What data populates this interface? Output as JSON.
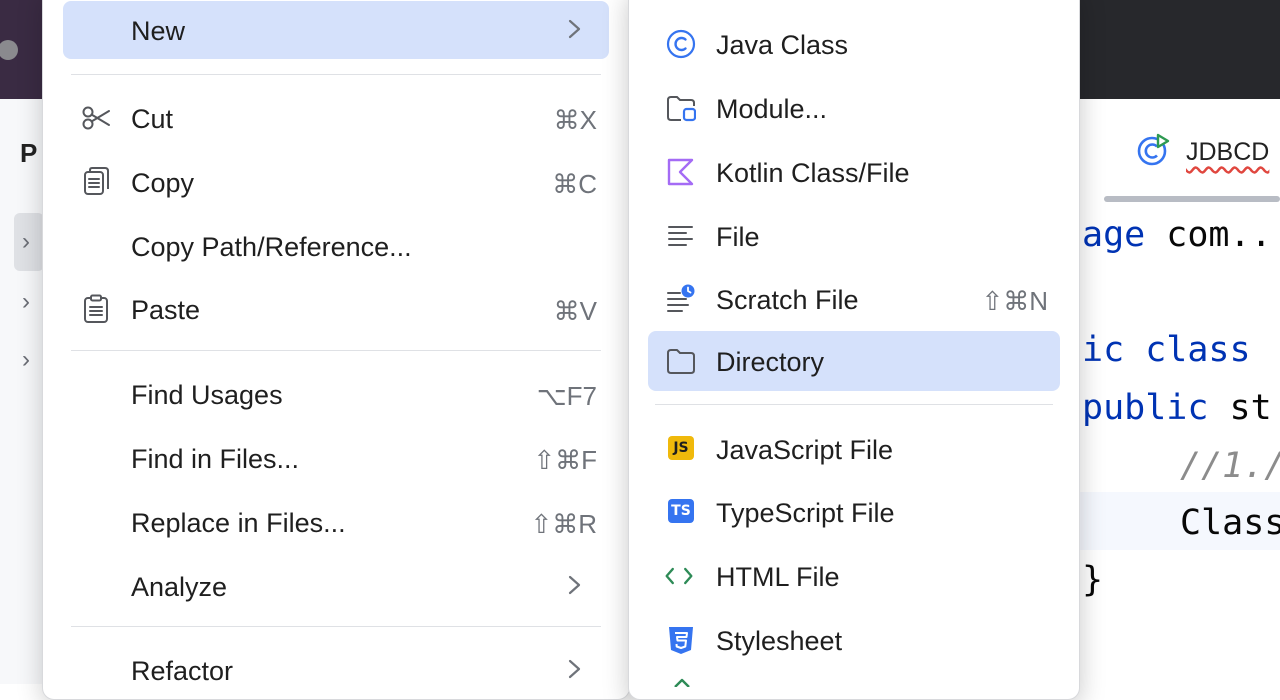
{
  "editor": {
    "project_label": "P",
    "tab_label": "JDBCD",
    "code_lines": [
      {
        "kw": "age",
        "pl": " com.."
      },
      {
        "kw": "ic class",
        "pl": ""
      },
      {
        "kw": "public",
        "pl": " st"
      },
      {
        "cm": "//1./"
      },
      {
        "pl": "Class"
      },
      {
        "pl": "}"
      }
    ]
  },
  "menu": {
    "items": [
      {
        "label": "New",
        "shortcut": "",
        "icon": "",
        "submenu": true,
        "selected": true
      },
      {
        "label": "Cut",
        "shortcut": "⌘X",
        "icon": "scissors-icon"
      },
      {
        "label": "Copy",
        "shortcut": "⌘C",
        "icon": "copy-icon"
      },
      {
        "label": "Copy Path/Reference...",
        "shortcut": "",
        "icon": ""
      },
      {
        "label": "Paste",
        "shortcut": "⌘V",
        "icon": "clipboard-icon"
      },
      {
        "label": "Find Usages",
        "shortcut": "⌥F7",
        "icon": ""
      },
      {
        "label": "Find in Files...",
        "shortcut": "⇧⌘F",
        "icon": ""
      },
      {
        "label": "Replace in Files...",
        "shortcut": "⇧⌘R",
        "icon": ""
      },
      {
        "label": "Analyze",
        "shortcut": "",
        "icon": "",
        "submenu": true
      },
      {
        "label": "Refactor",
        "shortcut": "",
        "icon": "",
        "submenu": true
      }
    ]
  },
  "submenu": {
    "items": [
      {
        "label": "Java Class",
        "shortcut": "",
        "icon": "java-class-icon"
      },
      {
        "label": "Module...",
        "shortcut": "",
        "icon": "module-folder-icon"
      },
      {
        "label": "Kotlin Class/File",
        "shortcut": "",
        "icon": "kotlin-icon"
      },
      {
        "label": "File",
        "shortcut": "",
        "icon": "file-lines-icon"
      },
      {
        "label": "Scratch File",
        "shortcut": "⇧⌘N",
        "icon": "scratch-file-icon"
      },
      {
        "label": "Directory",
        "shortcut": "",
        "icon": "folder-icon",
        "selected": true
      },
      {
        "label": "JavaScript File",
        "shortcut": "",
        "icon": "javascript-icon",
        "badge": "JS"
      },
      {
        "label": "TypeScript File",
        "shortcut": "",
        "icon": "typescript-icon",
        "badge": "TS"
      },
      {
        "label": "HTML File",
        "shortcut": "",
        "icon": "html-icon"
      },
      {
        "label": "Stylesheet",
        "shortcut": "",
        "icon": "css-icon"
      }
    ]
  },
  "colors": {
    "selection": "#d5e1fb",
    "shortcut": "#6f737a",
    "java_blue": "#3574f0",
    "kotlin_purple": "#a46bf5",
    "js_yellow": "#f0b90b",
    "ts_blue": "#3574f0",
    "html_green": "#2e8b57",
    "css_blue": "#3574f0"
  }
}
